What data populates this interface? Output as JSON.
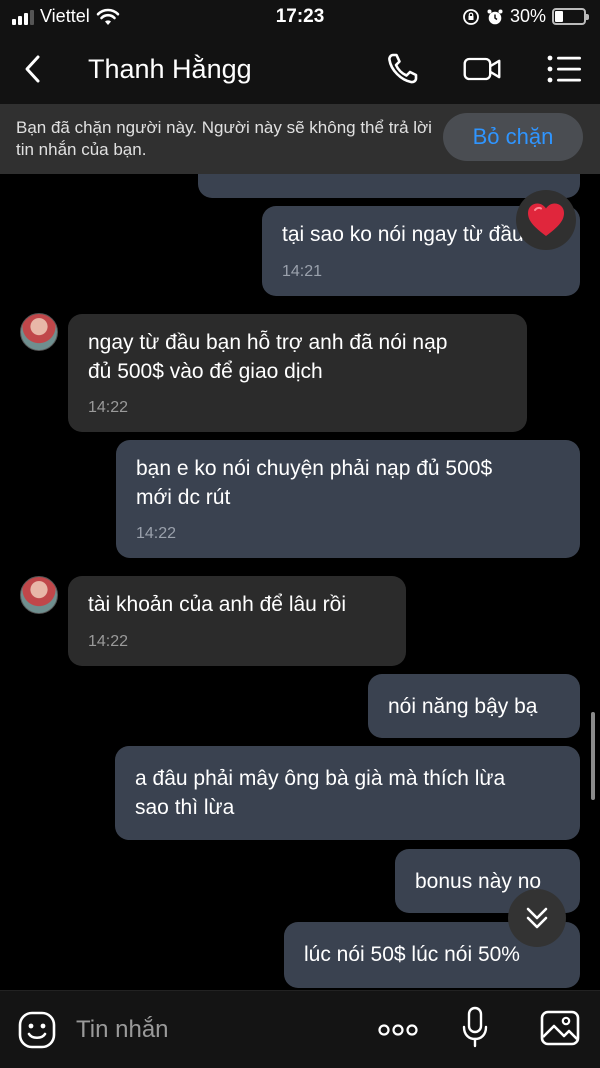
{
  "status_bar": {
    "carrier": "Viettel",
    "time": "17:23",
    "battery_percent": "30%",
    "battery_level": 0.3
  },
  "header": {
    "title": "Thanh Hằngg",
    "icons": [
      "back-icon",
      "phone-icon",
      "video-call-icon",
      "menu-icon"
    ]
  },
  "banner": {
    "text": "Bạn đã chặn người này. Người này sẽ không thể trả lời tin nhắn của bạn.",
    "button_label": "Bỏ chặn"
  },
  "messages": [
    {
      "direction": "sent",
      "lines": [
        "tại sao ko nói ngay từ đầu"
      ],
      "time": "14:21"
    },
    {
      "direction": "received",
      "lines": [
        "ngay từ đầu bạn hỗ trợ anh đã nói nạp",
        "đủ 500$ vào để giao dịch"
      ],
      "time": "14:22"
    },
    {
      "direction": "sent",
      "lines": [
        "bạn e ko nói chuyện phải nạp đủ 500$",
        "mới dc rút"
      ],
      "time": "14:22"
    },
    {
      "direction": "received",
      "lines": [
        "tài khoản của anh để lâu rồi"
      ],
      "time": "14:22"
    },
    {
      "direction": "sent",
      "lines": [
        "nói năng bậy bạ"
      ],
      "time": ""
    },
    {
      "direction": "sent",
      "lines": [
        "a đâu phải mây ông bà già mà thích lừa",
        "sao thì lừa"
      ],
      "time": ""
    },
    {
      "direction": "sent",
      "lines": [
        "bonus này nọ"
      ],
      "time": ""
    },
    {
      "direction": "sent",
      "lines": [
        "lúc nói 50$ lúc nói 50%"
      ],
      "time": ""
    }
  ],
  "reaction": {
    "icon": "heart-icon"
  },
  "input": {
    "placeholder": "Tin nhắn",
    "icons": [
      "emoji-icon",
      "more-icon",
      "microphone-icon",
      "gallery-icon"
    ]
  },
  "colors": {
    "background": "#000000",
    "sent_bubble": "#3a4250",
    "received_bubble": "#2b2b2b",
    "accent": "#2f95ff",
    "heart": "#e0263c"
  }
}
